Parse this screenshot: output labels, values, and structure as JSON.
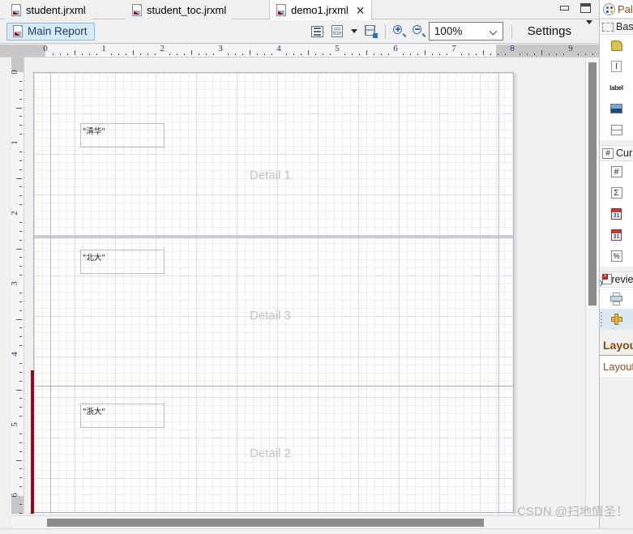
{
  "window": {
    "minimize_icon": "window-minimize-icon",
    "maximize_icon": "window-maximize-icon"
  },
  "tabs": [
    {
      "label": "student.jrxml",
      "icon": "report-file-icon",
      "active": false,
      "closable": false
    },
    {
      "label": "student_toc.jrxml",
      "icon": "report-file-icon",
      "active": false,
      "closable": false
    },
    {
      "label": "demo1.jrxml",
      "icon": "report-file-icon",
      "active": true,
      "closable": true,
      "close_glyph": "✕"
    }
  ],
  "toolbar": {
    "main_report_label": "Main Report",
    "main_report_icon": "report-file-icon",
    "outline_icon": "report-outline-icon",
    "source_icon": "xml-source-icon",
    "source_dropdown_icon": "chevron-down-icon",
    "compile_icon": "compile-report-icon",
    "zoom_in_icon": "zoom-in-icon",
    "zoom_out_icon": "zoom-out-icon",
    "zoom_value": "100%",
    "zoom_dropdown_icon": "chevron-down-icon",
    "settings_label": "Settings",
    "settings_dropdown_icon": "chevron-down-icon"
  },
  "rulers": {
    "horizontal": {
      "unit_labels": [
        "0",
        "1",
        "2",
        "3",
        "4",
        "5",
        "6",
        "7",
        "8",
        "9"
      ],
      "gray_start_label": "8"
    },
    "vertical": {
      "unit_labels": [
        "0",
        "1",
        "2",
        "3",
        "4",
        "5",
        "6"
      ]
    }
  },
  "canvas": {
    "bands": [
      {
        "label": "Detail 1"
      },
      {
        "label": "Detail 3"
      },
      {
        "label": "Detail 2"
      }
    ],
    "text_fields": [
      {
        "value": "\"清华\""
      },
      {
        "value": "\"北大\""
      },
      {
        "value": "\"浙大\""
      }
    ],
    "selection_marker": "band-selection-marker"
  },
  "palette": {
    "tab_label": "Palette",
    "tab_icon": "palette-icon",
    "sections": [
      {
        "title": "Basic Elements",
        "icon": "dashed-rect-icon",
        "items": [
          {
            "name": "band-element",
            "icon": "band-icon"
          },
          {
            "name": "text-field",
            "icon": "text-field-icon",
            "glyph": "I"
          },
          {
            "name": "static-text",
            "icon": "label-icon",
            "glyph": "label"
          },
          {
            "name": "image-element",
            "icon": "image-icon"
          },
          {
            "name": "break-element",
            "icon": "break-icon"
          }
        ]
      },
      {
        "title": "Current Report",
        "icon": "hash-box-icon",
        "items": [
          {
            "name": "page-number",
            "icon": "hash-icon",
            "glyph": "#"
          },
          {
            "name": "total-pages",
            "icon": "sigma-icon",
            "glyph": "Σ"
          },
          {
            "name": "current-date",
            "icon": "calendar-icon",
            "glyph": "31"
          },
          {
            "name": "current-time",
            "icon": "calendar-icon",
            "glyph": "31"
          },
          {
            "name": "percentage",
            "icon": "percent-icon",
            "glyph": "%"
          }
        ]
      },
      {
        "title": "Preview",
        "icon": "preview-icon",
        "items": [
          {
            "name": "print-preview",
            "icon": "printer-icon"
          },
          {
            "name": "ruler-tool",
            "icon": "ruler-icon",
            "selected": true
          }
        ]
      }
    ],
    "layout_header": "Layout",
    "layout_item": "Layout"
  },
  "scrollbars": {
    "vertical": "vertical-scrollbar",
    "horizontal": "horizontal-scrollbar"
  },
  "watermark": "CSDN @扫地情圣！"
}
